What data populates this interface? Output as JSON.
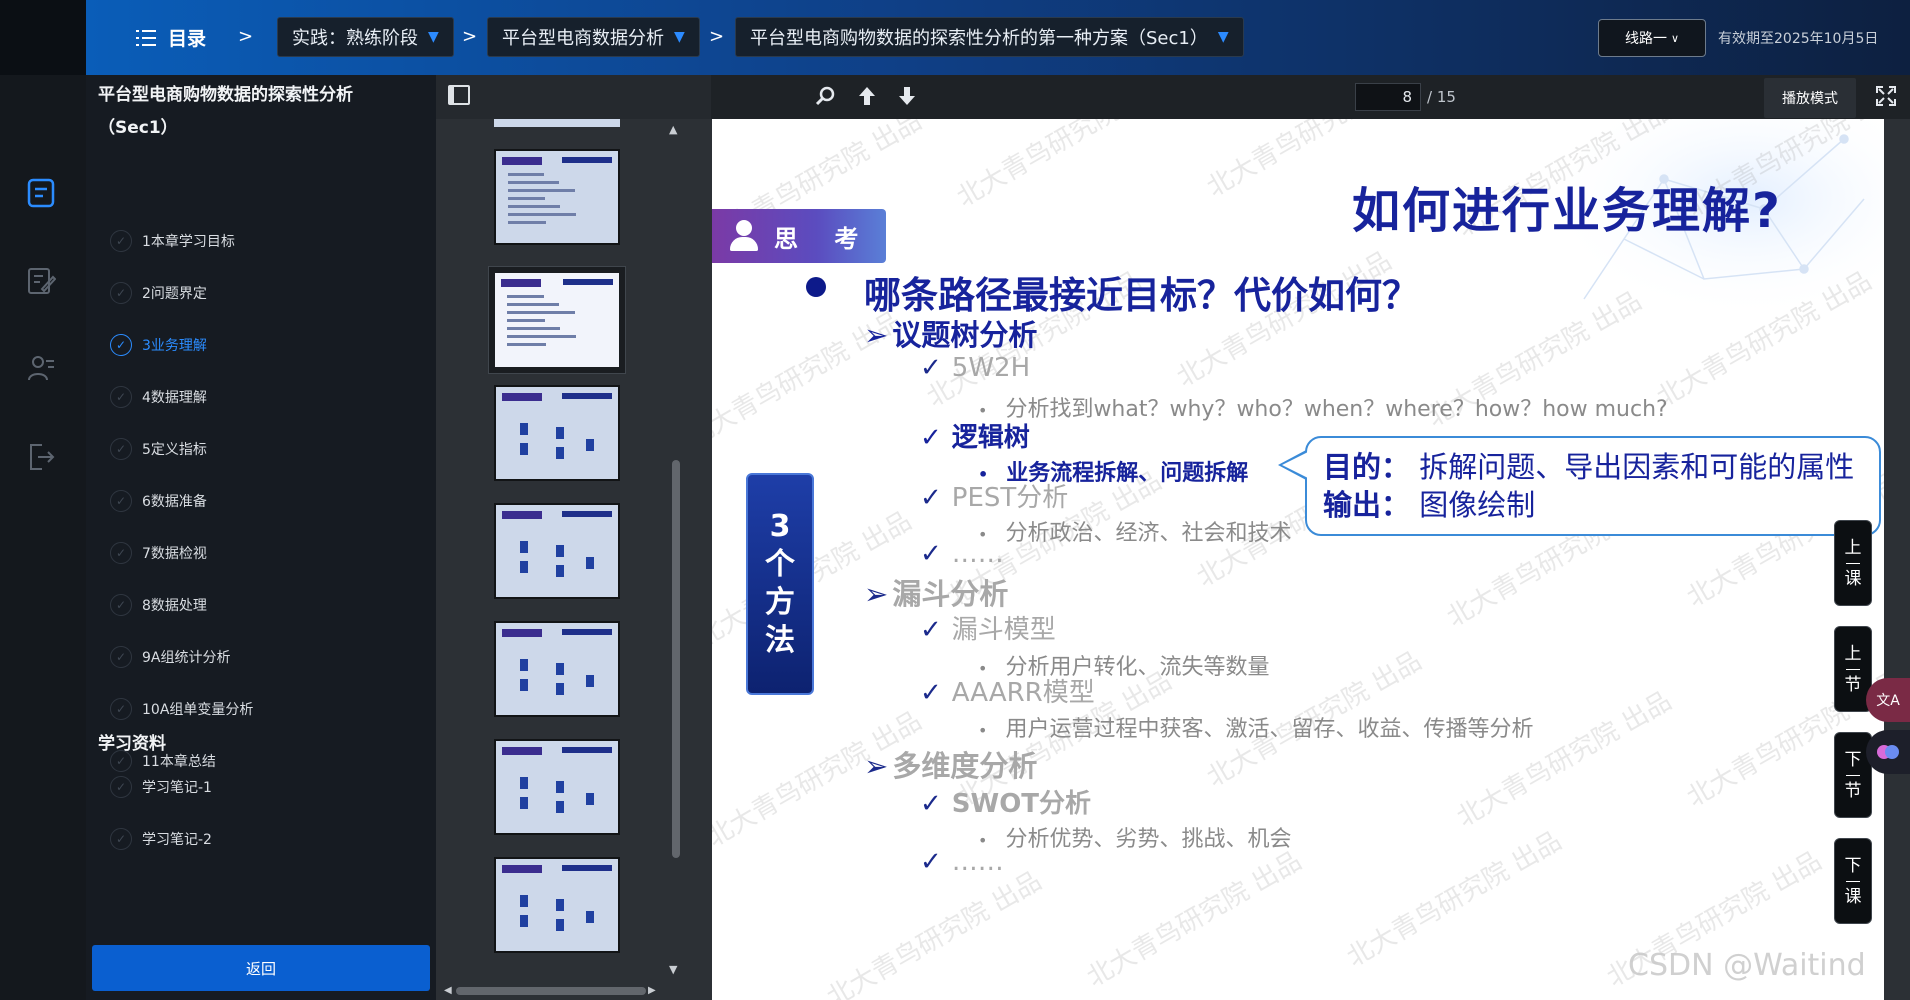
{
  "topbar": {
    "menu_label": "目录",
    "crumbs": [
      "实践：熟练阶段",
      "平台型电商数据分析",
      "平台型电商购物数据的探索性分析的第一种方案（Sec1）"
    ],
    "route_label": "线路一",
    "expire_text": "有效期至2025年10月5日"
  },
  "chapters": {
    "title": "平台型电商购物数据的探索性分析（Sec1）",
    "items": [
      {
        "label": "1本章学习目标",
        "active": false
      },
      {
        "label": "2问题界定",
        "active": false
      },
      {
        "label": "3业务理解",
        "active": true
      },
      {
        "label": "4数据理解",
        "active": false
      },
      {
        "label": "5定义指标",
        "active": false
      },
      {
        "label": "6数据准备",
        "active": false
      },
      {
        "label": "7数据检视",
        "active": false
      },
      {
        "label": "8数据处理",
        "active": false
      },
      {
        "label": "9A组统计分析",
        "active": false
      },
      {
        "label": "10A组单变量分析",
        "active": false
      },
      {
        "label": "11本章总结",
        "active": false
      }
    ],
    "materials_title": "学习资料",
    "materials": [
      {
        "label": "学习笔记-1"
      },
      {
        "label": "学习笔记-2"
      }
    ],
    "back_label": "返回"
  },
  "viewer": {
    "page_current": "8",
    "page_total": "/ 15",
    "play_mode_label": "播放模式"
  },
  "slide": {
    "title": "如何进行业务理解?",
    "badge": "思 考",
    "main_question": "哪条路径最接近目标？代价如何？",
    "methods_box": [
      "3",
      "个",
      "方",
      "法"
    ],
    "callout_purpose_label": "目的：",
    "callout_purpose": "拆解问题、导出因素和可能的属性",
    "callout_output_label": "输出：",
    "callout_output": "图像绘制",
    "s1_title": "议题树分析",
    "s1_a": "5W2H",
    "s1_a_sub": "分析找到what？why？who？when？where？how？how much?",
    "s1_b": "逻辑树",
    "s1_b_sub": "业务流程拆解、问题拆解",
    "s1_c": "PEST分析",
    "s1_c_sub": "分析政治、经济、社会和技术",
    "s1_d": "……",
    "s2_title": "漏斗分析",
    "s2_a": "漏斗模型",
    "s2_a_sub": "分析用户转化、流失等数量",
    "s2_b": "AAARR模型",
    "s2_b_sub": "用户运营过程中获客、激活、留存、收益、传播等分析",
    "s3_title": "多维度分析",
    "s3_a": "SWOT分析",
    "s3_a_sub": "分析优势、劣势、挑战、机会",
    "s3_b": "……",
    "watermark": "北大青鸟研究院 出品"
  },
  "side_nav": {
    "prev_lesson": [
      "上",
      "课"
    ],
    "prev_section": [
      "上",
      "节"
    ],
    "next_section": [
      "下",
      "节"
    ],
    "next_lesson": [
      "下",
      "课"
    ]
  },
  "footer_watermark": "CSDN @Waitind",
  "colors": {
    "accent_blue": "#0a5fd0",
    "slide_title": "#17239c",
    "active_chapter": "#2b8cff"
  },
  "icons": {
    "menu": "list-icon",
    "search": "search-icon",
    "up": "arrow-up-icon",
    "down": "arrow-down-icon",
    "fullscreen": "fullscreen-icon"
  }
}
